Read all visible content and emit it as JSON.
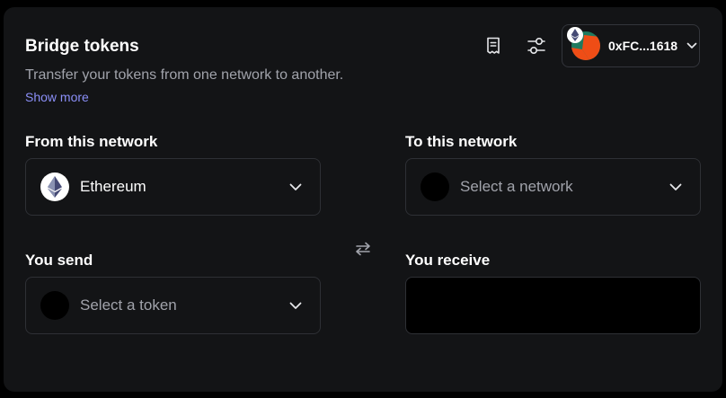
{
  "header": {
    "title": "Bridge tokens",
    "subtitle": "Transfer your tokens from one network to another.",
    "show_more": "Show more"
  },
  "toolbar": {
    "history_icon": "receipt-icon",
    "settings_icon": "sliders-icon"
  },
  "wallet": {
    "address": "0xFC...1618",
    "avatar_icon": "ethereum-icon"
  },
  "from": {
    "label": "From this network",
    "network": "Ethereum",
    "network_icon": "ethereum-icon"
  },
  "to": {
    "label": "To this network",
    "placeholder": "Select a network"
  },
  "send": {
    "label": "You send",
    "placeholder": "Select a token"
  },
  "receive": {
    "label": "You receive"
  },
  "swap_icon": "swap-arrows-icon",
  "colors": {
    "background": "#131416",
    "border": "#2e3035",
    "muted_text": "#a1a3ab",
    "link": "#8b8ff8",
    "avatar_green": "#1e7a5f",
    "avatar_orange": "#ef4d16"
  }
}
